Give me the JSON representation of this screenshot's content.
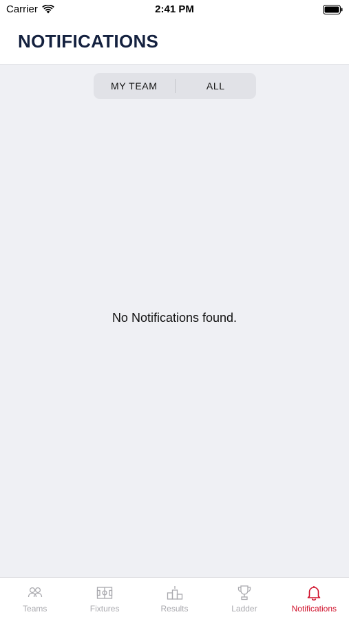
{
  "status_bar": {
    "carrier": "Carrier",
    "time": "2:41 PM"
  },
  "header": {
    "title": "NOTIFICATIONS"
  },
  "segmented_control": {
    "segments": [
      {
        "label": "MY TEAM"
      },
      {
        "label": "ALL"
      }
    ]
  },
  "main": {
    "empty_message": "No Notifications found."
  },
  "tab_bar": {
    "active": "Notifications",
    "active_color": "#d0102a",
    "inactive_color": "#a9a9ae",
    "tabs": [
      {
        "label": "Teams",
        "icon": "people-icon"
      },
      {
        "label": "Fixtures",
        "icon": "pitch-icon"
      },
      {
        "label": "Results",
        "icon": "podium-icon"
      },
      {
        "label": "Ladder",
        "icon": "trophy-icon"
      },
      {
        "label": "Notifications",
        "icon": "bell-icon"
      }
    ]
  }
}
